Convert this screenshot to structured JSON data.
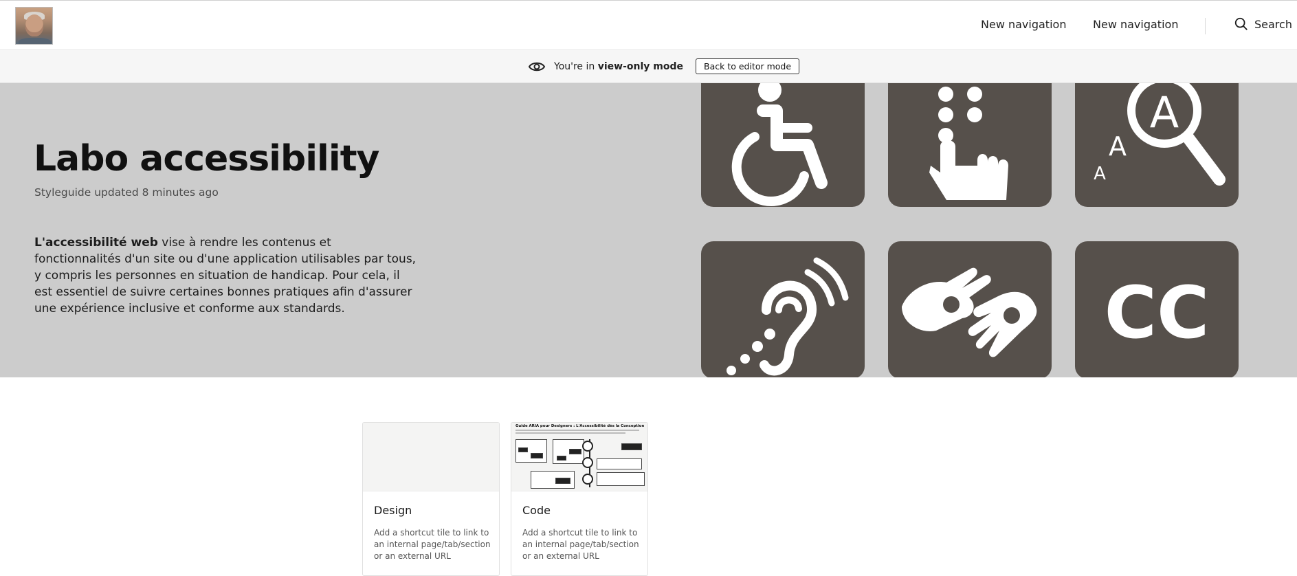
{
  "header": {
    "nav_items": [
      "New navigation",
      "New navigation"
    ],
    "search_label": "Search"
  },
  "view_bar": {
    "prefix": "You're in",
    "mode": "view-only mode",
    "button_label": "Back to editor mode"
  },
  "hero": {
    "title": "Labo accessibility",
    "subtitle": "Styleguide updated 8 minutes ago",
    "desc_bold": "L'accessibilité web",
    "desc_rest": " vise à rendre les contenus et fonctionnalités d'un site ou d'une application utilisables par tous, y compris les personnes en situation de handicap. Pour cela, il est essentiel de suivre certaines bonnes pratiques afin d'assurer une expérience inclusive et conforme aux standards.",
    "tile_icons": [
      "wheelchair-icon",
      "braille-touch-icon",
      "low-vision-magnifier-icon",
      "hearing-assist-icon",
      "sign-language-icon",
      "closed-captions-icon"
    ],
    "cc_text": "CC",
    "tile_color": "#56504b",
    "background_color": "#cccccc"
  },
  "cards": [
    {
      "title": "Design",
      "desc": "Add a shortcut tile to link to an internal page/tab/section or an external URL"
    },
    {
      "title": "Code",
      "desc": "Add a shortcut tile to link to an internal page/tab/section or an external URL",
      "thumb_title": "Guide ARIA pour Designers : L'Accessibilité dès la Conception"
    }
  ]
}
